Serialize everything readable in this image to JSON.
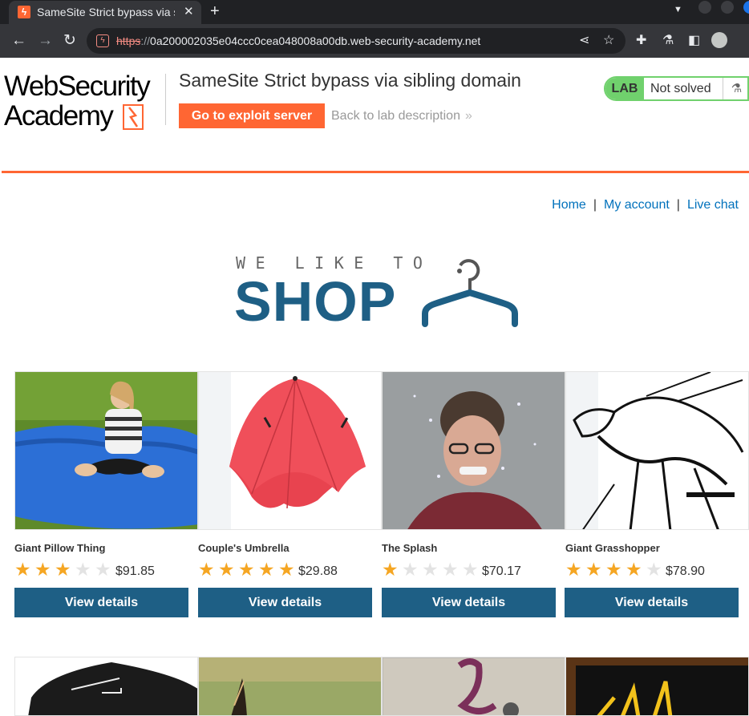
{
  "browser": {
    "tab_title": "SameSite Strict bypass via sibling domain",
    "tab_close": "✕",
    "new_tab": "+",
    "url_scheme": "https",
    "url_sep": "://",
    "url_host": "0a200002035e04ccc0cea048008a00db.web-security-academy.net"
  },
  "academy": {
    "logo_line1": "WebSecurity",
    "logo_line2": "Academy",
    "lab_title": "SameSite Strict bypass via sibling domain",
    "exploit_button": "Go to exploit server",
    "back_link": "Back to lab description",
    "back_chevron": "»",
    "lab_badge": "LAB",
    "lab_status": "Not solved"
  },
  "shop_nav": {
    "home": "Home",
    "separator": "|",
    "my_account": "My account",
    "live_chat": "Live chat"
  },
  "shop_logo": {
    "tagline": "WE LIKE TO",
    "word": "SHOP"
  },
  "products": [
    {
      "name": "Giant Pillow Thing",
      "rating": 3,
      "price": "$91.85",
      "button": "View details"
    },
    {
      "name": "Couple's Umbrella",
      "rating": 5,
      "price": "$29.88",
      "button": "View details"
    },
    {
      "name": "The Splash",
      "rating": 1,
      "price": "$70.17",
      "button": "View details"
    },
    {
      "name": "Giant Grasshopper",
      "rating": 4,
      "price": "$78.90",
      "button": "View details"
    }
  ],
  "colors": {
    "accent_orange": "#ff6633",
    "shop_blue": "#1e5f85",
    "link_blue": "#0071bc",
    "lab_green": "#70d16d",
    "star_gold": "#f5a623"
  }
}
